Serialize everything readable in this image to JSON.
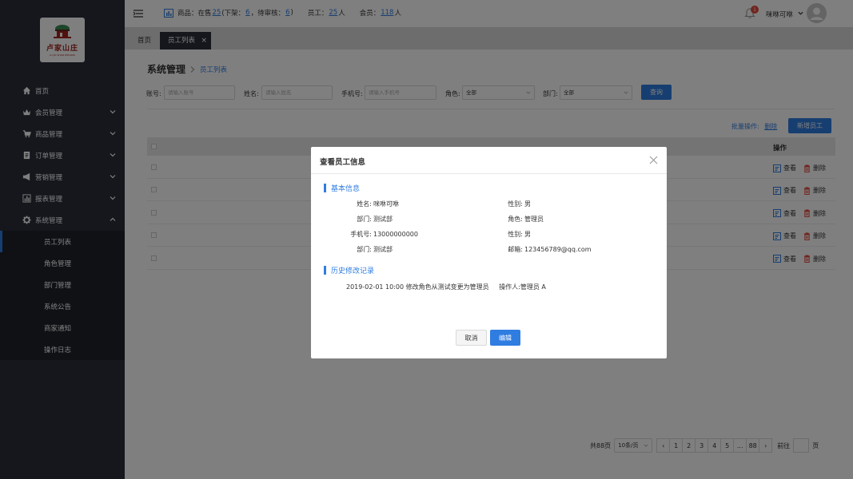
{
  "brand": {
    "logo_text": "卢家山庄",
    "logo_sub": "LU JIA SHAN ZHUANG"
  },
  "sidebar": {
    "items": [
      {
        "label": "首页"
      },
      {
        "label": "会员管理"
      },
      {
        "label": "商品管理"
      },
      {
        "label": "订单管理"
      },
      {
        "label": "营销管理"
      },
      {
        "label": "报表管理"
      },
      {
        "label": "系统管理"
      }
    ],
    "sub_items": [
      {
        "label": "员工列表"
      },
      {
        "label": "角色管理"
      },
      {
        "label": "部门管理"
      },
      {
        "label": "系统公告"
      },
      {
        "label": "商家通知"
      },
      {
        "label": "操作日志"
      }
    ]
  },
  "topbar": {
    "goods_label": "商品：在售",
    "on_sale": "25",
    "off_label": "(下架：",
    "off_shelf": "6",
    "pending_label": "，待审核：",
    "pending": "6",
    "close_paren": ")",
    "staff_label": "员工：",
    "staff": "25",
    "staff_unit": "人",
    "member_label": "会员：",
    "members": "118",
    "member_unit": "人",
    "notify_count": "1",
    "username": "咪咻可咻"
  },
  "tabs": {
    "home": "首页",
    "active": "员工列表",
    "close": "×"
  },
  "breadcrumb": {
    "section": "系统管理",
    "page": "员工列表"
  },
  "filters": {
    "account_label": "账号:",
    "account_placeholder": "请输入账号",
    "name_label": "姓名:",
    "name_placeholder": "请输入姓名",
    "phone_label": "手机号:",
    "phone_placeholder": "请输入手机号",
    "role_label": "角色:",
    "role_value": "全部",
    "dept_label": "部门:",
    "dept_value": "全部",
    "query_button": "查询"
  },
  "actions": {
    "batch_label": "批量操作:",
    "delete_link": "删除",
    "add_button": "新增员工"
  },
  "table": {
    "op_header": "操作",
    "view_label": "查看",
    "delete_label": "删除",
    "rows": 5
  },
  "pagination": {
    "total": "共88页",
    "page_size": "10条/页",
    "prev": "‹",
    "pages": [
      "1",
      "2",
      "3",
      "4",
      "5",
      "...",
      "88"
    ],
    "next": "›",
    "goto": "前往",
    "page_unit": "页"
  },
  "modal": {
    "title": "查看员工信息",
    "section_basic": "基本信息",
    "fields": {
      "name_k": "姓名:",
      "name_v": "咪咻可咻",
      "gender_k": "性别:",
      "gender_v": "男",
      "dept_k": "部门:",
      "dept_v": "测试部",
      "role_k": "角色:",
      "role_v": "管理员",
      "phone_k": "手机号:",
      "phone_v": "13000000000",
      "gender2_k": "性别:",
      "gender2_v": "男",
      "dept2_k": "部门:",
      "dept2_v": "测试部",
      "email_k": "邮箱:",
      "email_v": "123456789@qq.com"
    },
    "section_history": "历史修改记录",
    "history_entry": "2019-02-01 10:00 修改角色从测试变更为管理员",
    "history_operator": "操作人:管理员 A",
    "cancel_button": "取消",
    "edit_button": "编辑"
  },
  "colors": {
    "sidebar_bg": "#2b2f3a",
    "accent": "#2f7de1",
    "badge": "#e3483d",
    "delete_icon": "#e3483d"
  }
}
